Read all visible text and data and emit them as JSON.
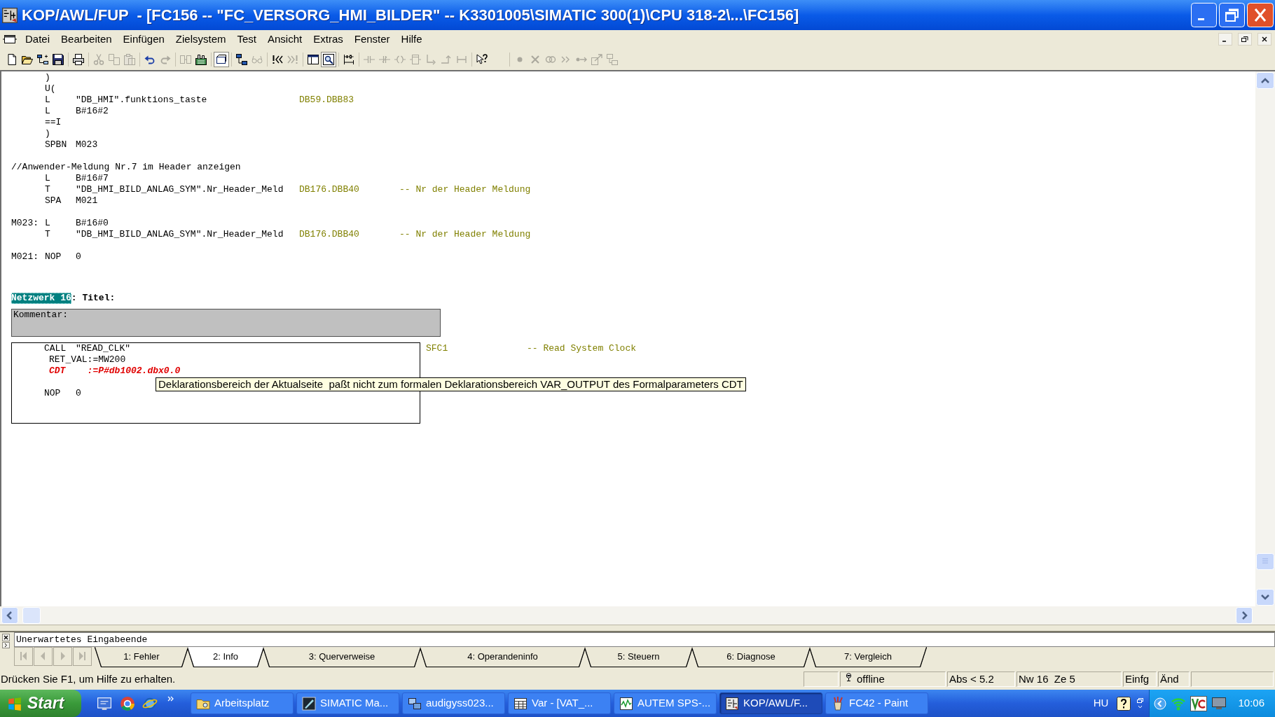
{
  "window": {
    "title": "KOP/AWL/FUP  - [FC156 -- \"FC_VERSORG_HMI_BILDER\" -- K3301005\\SIMATIC 300(1)\\CPU 318-2\\...\\FC156]"
  },
  "menu": [
    "Datei",
    "Bearbeiten",
    "Einfügen",
    "Zielsystem",
    "Test",
    "Ansicht",
    "Extras",
    "Fenster",
    "Hilfe"
  ],
  "toolbar": [
    [
      {
        "kind": "new",
        "disabled": false,
        "pressed": false
      },
      {
        "kind": "open",
        "disabled": false,
        "pressed": false
      },
      {
        "kind": "tree",
        "disabled": false,
        "pressed": false
      },
      {
        "kind": "save",
        "disabled": false,
        "pressed": false
      }
    ],
    [
      {
        "kind": "print",
        "disabled": false,
        "pressed": false
      }
    ],
    [
      {
        "kind": "cut",
        "disabled": true,
        "pressed": false
      },
      {
        "kind": "copy",
        "disabled": true,
        "pressed": false
      },
      {
        "kind": "paste",
        "disabled": true,
        "pressed": false
      }
    ],
    [
      {
        "kind": "undo",
        "disabled": false,
        "pressed": false
      },
      {
        "kind": "redo",
        "disabled": true,
        "pressed": false
      }
    ],
    [
      {
        "kind": "panels",
        "disabled": true,
        "pressed": false
      },
      {
        "kind": "module",
        "disabled": false,
        "pressed": false
      }
    ],
    [
      {
        "kind": "frame",
        "disabled": false,
        "pressed": true
      }
    ],
    [
      {
        "kind": "network",
        "disabled": false,
        "pressed": false
      },
      {
        "kind": "glasses",
        "disabled": true,
        "pressed": false
      }
    ],
    [
      {
        "kind": "prev",
        "disabled": false,
        "pressed": false
      },
      {
        "kind": "next",
        "disabled": true,
        "pressed": false
      }
    ],
    [
      {
        "kind": "split",
        "disabled": false,
        "pressed": false
      },
      {
        "kind": "zoom",
        "disabled": false,
        "pressed": true
      }
    ],
    [
      {
        "kind": "ladder",
        "disabled": false,
        "pressed": false
      }
    ],
    [
      {
        "kind": "contact",
        "disabled": true,
        "pressed": false
      },
      {
        "kind": "ncontact",
        "disabled": true,
        "pressed": false
      },
      {
        "kind": "coil",
        "disabled": true,
        "pressed": false
      },
      {
        "kind": "box",
        "disabled": true,
        "pressed": false
      },
      {
        "kind": "branch",
        "disabled": true,
        "pressed": false
      },
      {
        "kind": "close_branch",
        "disabled": true,
        "pressed": false
      },
      {
        "kind": "connector",
        "disabled": true,
        "pressed": false
      }
    ],
    [
      {
        "kind": "help",
        "disabled": false,
        "pressed": false
      }
    ],
    [
      {
        "kind": "dot",
        "disabled": true,
        "pressed": false
      },
      {
        "kind": "cross",
        "disabled": true,
        "pressed": false
      },
      {
        "kind": "circles",
        "disabled": true,
        "pressed": false
      },
      {
        "kind": "chevrons",
        "disabled": true,
        "pressed": false
      },
      {
        "kind": "dot_arrow",
        "disabled": true,
        "pressed": false
      },
      {
        "kind": "box_arrow",
        "disabled": true,
        "pressed": false
      },
      {
        "kind": "linked",
        "disabled": true,
        "pressed": false
      }
    ]
  ],
  "editor": {
    "blocks": [
      {
        "lines": [
          {
            "kind": "statement",
            "op": ")"
          },
          {
            "kind": "statement",
            "op": "U("
          },
          {
            "kind": "statement",
            "op": "L",
            "operand": "\"DB_HMI\".funktions_taste",
            "address": "DB59.DBB83"
          },
          {
            "kind": "statement",
            "op": "L",
            "operand": "B#16#2"
          },
          {
            "kind": "statement",
            "op": "==I"
          },
          {
            "kind": "statement",
            "op": ")"
          },
          {
            "kind": "statement",
            "op": "SPBN",
            "operand": "M023"
          }
        ]
      },
      {
        "lines": [
          {
            "kind": "comment",
            "text": "//Anwender-Meldung Nr.7 im Header anzeigen"
          },
          {
            "kind": "statement",
            "op": "L",
            "operand": "B#16#7"
          },
          {
            "kind": "statement",
            "op": "T",
            "operand": "\"DB_HMI_BILD_ANLAG_SYM\".Nr_Header_Meld",
            "address": "DB176.DBB40",
            "comment": "-- Nr der Header Meldung"
          },
          {
            "kind": "statement",
            "op": "SPA",
            "operand": "M021"
          }
        ]
      },
      {
        "lines": [
          {
            "kind": "statement",
            "label": "M023:",
            "op": "L",
            "operand": "B#16#0"
          },
          {
            "kind": "statement",
            "op": "T",
            "operand": "\"DB_HMI_BILD_ANLAG_SYM\".Nr_Header_Meld",
            "address": "DB176.DBB40",
            "comment": "-- Nr der Header Meldung"
          }
        ]
      },
      {
        "lines": [
          {
            "kind": "statement",
            "label": "M021:",
            "op": "NOP",
            "operand": "0"
          }
        ]
      }
    ],
    "network": {
      "title": "Netzwerk 16",
      "selected": true,
      "caption": ": Titel:",
      "comment_label": "Kommentar:",
      "blocks": [
        {
          "lines": [
            {
              "kind": "statement",
              "op": "CALL",
              "operand": "\"READ_CLK\"",
              "address": "SFC1",
              "comment": "-- Read System Clock"
            },
            {
              "kind": "parameter",
              "text": "RET_VAL:=MW200",
              "error": false
            },
            {
              "kind": "parameter",
              "text": "CDT    :=P#db1002.dbx0.0",
              "error": true
            }
          ]
        },
        {
          "lines": [
            {
              "kind": "statement",
              "op": "NOP",
              "operand": "0"
            }
          ]
        }
      ]
    },
    "tooltip": "Deklarationsbereich der Aktualseite  paßt nicht zum formalen Deklarationsbereich VAR_OUTPUT des Formalparameters CDT"
  },
  "output_panel": {
    "message": "Unerwartetes Eingabeende",
    "tab_nav": [
      {
        "kind": "first",
        "disabled": true
      },
      {
        "kind": "previous",
        "disabled": true
      },
      {
        "kind": "next",
        "disabled": true
      },
      {
        "kind": "last",
        "disabled": true
      }
    ],
    "tabs": [
      {
        "label": "1: Fehler",
        "selected": false
      },
      {
        "label": "2: Info",
        "selected": true
      },
      {
        "label": "3: Querverweise",
        "selected": false
      },
      {
        "label": "4: Operandeninfo",
        "selected": false
      },
      {
        "label": "5: Steuern",
        "selected": false
      },
      {
        "label": "6: Diagnose",
        "selected": false
      },
      {
        "label": "7: Vergleich",
        "selected": false
      }
    ]
  },
  "status_bar": {
    "hint": "Drücken Sie F1, um Hilfe zu erhalten.",
    "panes": [
      {
        "kind": "connection",
        "text": "offline"
      },
      {
        "kind": "plain",
        "text": "Abs < 5.2"
      },
      {
        "kind": "plain",
        "text": "Nw 16  Ze 5"
      },
      {
        "kind": "plain",
        "text": "Einfg"
      },
      {
        "kind": "plain",
        "text": "Änd"
      }
    ]
  },
  "taskbar": {
    "start": "Start",
    "tasks": [
      {
        "kind": "folder",
        "label": "Arbeitsplatz",
        "selected": false
      },
      {
        "kind": "pen",
        "label": "SIMATIC Ma...",
        "selected": false
      },
      {
        "kind": "computers",
        "label": "audigyss023...",
        "selected": false
      },
      {
        "kind": "table",
        "label": "Var - [VAT_...",
        "selected": false
      },
      {
        "kind": "chart",
        "label": "AUTEM SPS-...",
        "selected": false
      },
      {
        "kind": "ladder",
        "label": "KOP/AWL/F...",
        "selected": true
      },
      {
        "kind": "paint",
        "label": "FC42 - Paint",
        "selected": false
      }
    ],
    "language": "HU",
    "clock": "10:06"
  }
}
